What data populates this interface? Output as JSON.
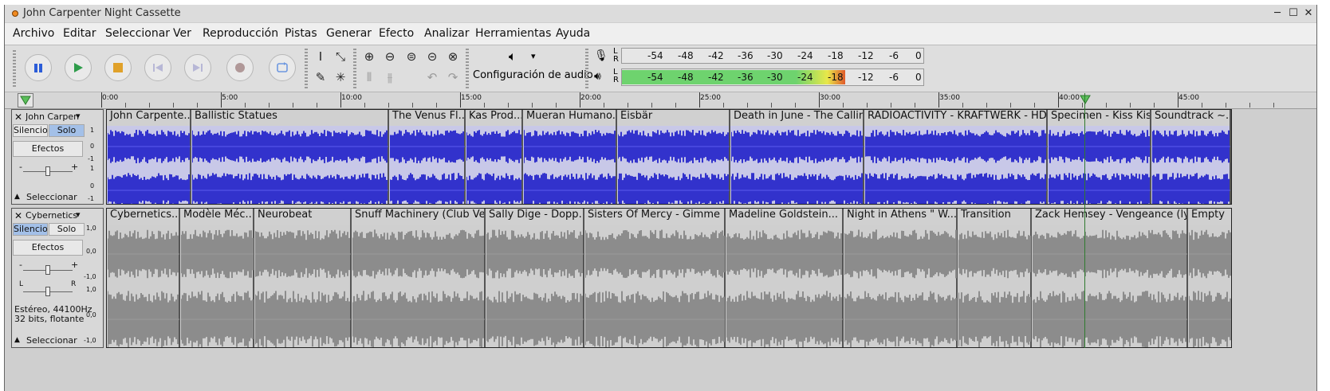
{
  "window": {
    "title": "John Carpenter Night Cassette",
    "minimize": "─",
    "maximize": "☐",
    "close": "✕"
  },
  "menu": [
    "Archivo",
    "Editar",
    "Seleccionar",
    "Ver",
    "Reproducción",
    "Pistas",
    "Generar",
    "Efecto",
    "Analizar",
    "Herramientas",
    "Ayuda"
  ],
  "toolbar": {
    "transport": [
      {
        "name": "pause-button",
        "icon": "pause-icon"
      },
      {
        "name": "play-button",
        "icon": "play-icon"
      },
      {
        "name": "stop-button",
        "icon": "stop-icon"
      },
      {
        "name": "skip-start-button",
        "icon": "skip-start-icon"
      },
      {
        "name": "skip-end-button",
        "icon": "skip-end-icon"
      },
      {
        "name": "record-button",
        "icon": "record-icon"
      },
      {
        "name": "loop-button",
        "icon": "loop-icon"
      }
    ],
    "audio_setup_label": "Configuración de audio",
    "audio_setup_icon": "speaker-icon",
    "audio_setup_arrow": "▾",
    "record_meter": {
      "channels": [
        "L",
        "R"
      ],
      "scale": [
        "-54",
        "-48",
        "-42",
        "-36",
        "-30",
        "-24",
        "-18",
        "-12",
        "-6",
        "0"
      ]
    },
    "play_meter": {
      "channels": [
        "L",
        "R"
      ],
      "scale": [
        "-54",
        "-48",
        "-42",
        "-36",
        "-30",
        "-24",
        "-18",
        "-12",
        "-6",
        "0"
      ],
      "level_fraction": 0.74
    },
    "colors": {
      "meter_green": "#6ed36e",
      "meter_yellow": "#e8e84a",
      "meter_red": "#e05a2a",
      "track1_wave": "#3232cc",
      "track2_wave": "#8c8c8c"
    }
  },
  "ruler": {
    "ticks": [
      "0:00",
      "5:00",
      "10:00",
      "15:00",
      "20:00",
      "25:00",
      "30:00",
      "35:00",
      "40:00",
      "45:00"
    ],
    "playhead_time": "40:50"
  },
  "tracks": [
    {
      "name": "John Carpen",
      "mute": "Silencio",
      "solo": "Solo",
      "effects": "Efectos",
      "select": "Seleccionar",
      "gain_min": "-",
      "gain_max": "+",
      "scale": [
        "1",
        "0",
        "-1"
      ],
      "clips": [
        {
          "name": "John Carpente..."
        },
        {
          "name": "Ballistic Statues"
        },
        {
          "name": "The Venus Fl..."
        },
        {
          "name": "Kas Prod..."
        },
        {
          "name": "Mueran Humano..."
        },
        {
          "name": "Eisbär"
        },
        {
          "name": "Death in June - The Callin..."
        },
        {
          "name": "RADIOACTIVITY - KRAFTWERK - HD L..."
        },
        {
          "name": "Specimen - Kiss Kis..."
        },
        {
          "name": "Soundtrack ~..."
        }
      ]
    },
    {
      "name": "Cybernetics",
      "mute": "Silencio",
      "solo": "Solo",
      "effects": "Efectos",
      "select": "Seleccionar",
      "gain_min": "-",
      "gain_max": "+",
      "pan_left": "L",
      "pan_right": "R",
      "info_line1": "Estéreo, 44100Hz",
      "info_line2": "32 bits, flotante",
      "scale": [
        "1,0",
        "0,0",
        "-1,0"
      ],
      "clips": [
        {
          "name": "Cybernetics..."
        },
        {
          "name": "Modèle Méc..."
        },
        {
          "name": "Neurobeat"
        },
        {
          "name": "Snuff Machinery (Club Ve..."
        },
        {
          "name": "Sally Dige - Dopp..."
        },
        {
          "name": "Sisters Of Mercy - Gimme S..."
        },
        {
          "name": "Madeline Goldstein..."
        },
        {
          "name": "Night in Athens  \" W..."
        },
        {
          "name": "Transition"
        },
        {
          "name": "Zack Hemsey - Vengeance (lyr..."
        },
        {
          "name": "Empty"
        }
      ]
    }
  ]
}
